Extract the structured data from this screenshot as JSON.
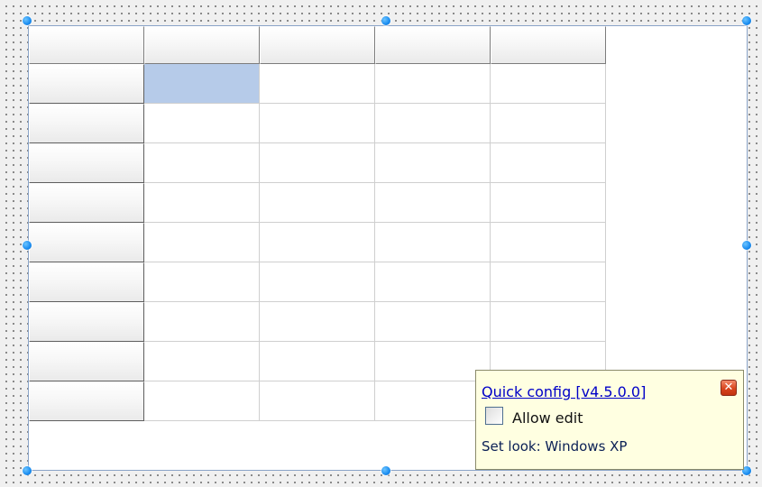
{
  "grid": {
    "columns": 5,
    "data_rows": 9,
    "selected_cell": {
      "row": 1,
      "column": 1
    }
  },
  "quick_config": {
    "title": "Quick config [v4.5.0.0]",
    "close_glyph": "✕",
    "close_icon": "close-icon",
    "allow_edit_label": "Allow edit",
    "allow_edit_checked": false,
    "look_text": "Set look: Windows XP"
  },
  "colors": {
    "selection": "#b6cbe9",
    "handle": "#1a8cf0",
    "popup_background": "#ffffe1",
    "link": "#0000c8"
  }
}
